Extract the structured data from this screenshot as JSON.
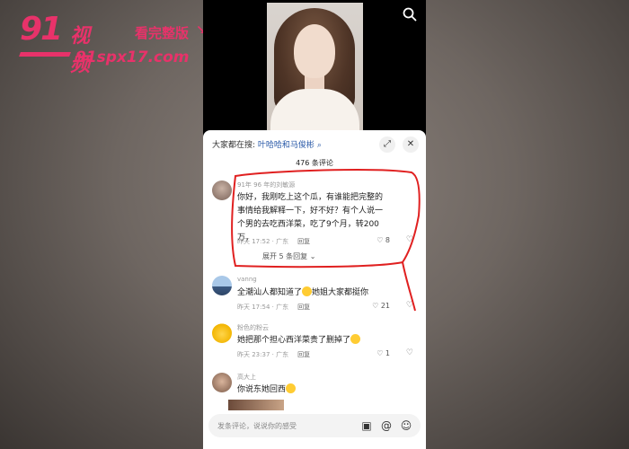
{
  "watermark": {
    "logo_number": "91",
    "logo_text": "视频",
    "tagline": "看完整版",
    "arrows": "↘↘",
    "url": "91spx17.com"
  },
  "video": {
    "search_icon": "search-icon"
  },
  "sheet": {
    "search_prefix": "大家都在搜:",
    "search_term": "叶哈哈和马俊彬",
    "search_term_icon": "search-icon",
    "fullscreen_icon": "expand-icon",
    "close_icon": "close-icon",
    "comment_count": "476 条评论"
  },
  "comments": [
    {
      "user": "91年 96 年的刘敏源",
      "text": "你好，我刚吃上这个瓜，有谁能把完整的事情给我解释一下，好不好？有个人说一个男的去吃西洋菜，吃了9个月，转200万，",
      "time": "昨天 17:52 · 广东",
      "reply": "回复",
      "likes": "8",
      "expand": "展开 5 条回复"
    },
    {
      "user": "vanng",
      "text": "全潮汕人都知道了",
      "text_suffix": "她姐大家都挺你",
      "time": "昨天 17:54 · 广东",
      "reply": "回复",
      "likes": "21"
    },
    {
      "user": "粉色的粉云",
      "text": "她把那个担心西洋菜贵了删掉了",
      "time": "昨天 23:37 · 广东",
      "reply": "回复",
      "likes": "1"
    },
    {
      "user": "高大上",
      "text": "你说东她回西",
      "time": "",
      "reply": "",
      "likes": ""
    }
  ],
  "input": {
    "placeholder": "发条评论，说说你的感受",
    "image_icon": "image-icon",
    "at_icon": "at-icon",
    "emoji_icon": "emoji-icon"
  },
  "colors": {
    "watermark": "#e8326a",
    "annotation": "#e02020",
    "link": "#2a5aa8"
  }
}
